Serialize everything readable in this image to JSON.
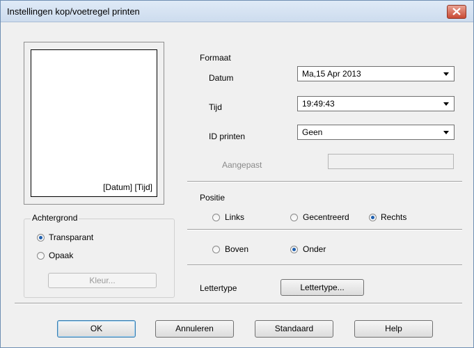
{
  "window": {
    "title": "Instellingen kop/voetregel printen"
  },
  "preview": {
    "label": "[Datum] [Tijd]"
  },
  "background": {
    "group_label": "Achtergrond",
    "transparent_label": "Transparant",
    "opaque_label": "Opaak",
    "selected": "Transparant",
    "color_button": "Kleur..."
  },
  "format": {
    "heading": "Formaat",
    "date_label": "Datum",
    "date_value": "Ma,15 Apr 2013",
    "time_label": "Tijd",
    "time_value": "19:49:43",
    "id_label": "ID printen",
    "id_value": "Geen",
    "custom_label": "Aangepast",
    "custom_value": ""
  },
  "position": {
    "heading": "Positie",
    "left_label": "Links",
    "center_label": "Gecentreerd",
    "right_label": "Rechts",
    "top_label": "Boven",
    "bottom_label": "Onder",
    "selected_horizontal": "Rechts",
    "selected_vertical": "Onder"
  },
  "font": {
    "label": "Lettertype",
    "button": "Lettertype..."
  },
  "footer": {
    "ok": "OK",
    "cancel": "Annuleren",
    "default": "Standaard",
    "help": "Help"
  },
  "colors": {
    "title_close": "#c94b35",
    "radio_selected": "#1e5fae"
  }
}
